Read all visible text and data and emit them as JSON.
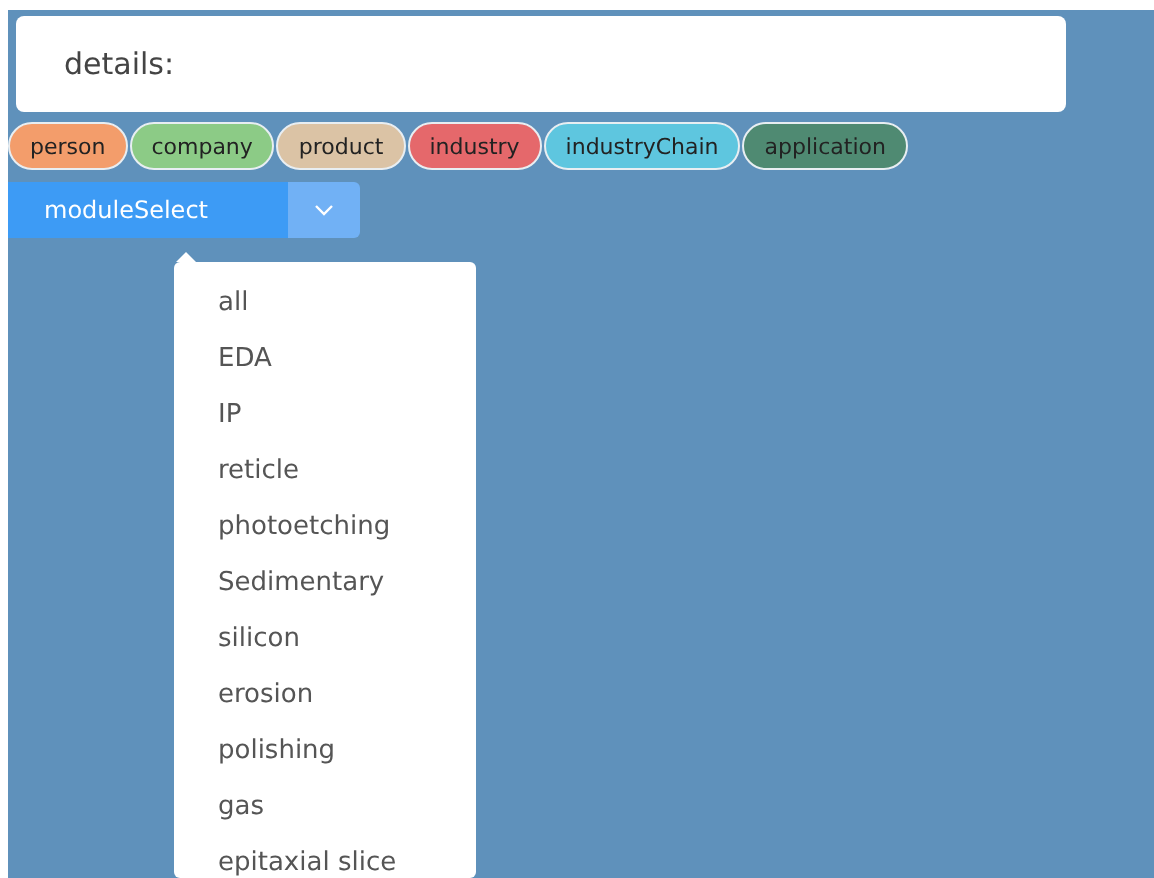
{
  "details": {
    "label": "details:"
  },
  "tags": [
    {
      "label": "person",
      "color": "#f39d6b"
    },
    {
      "label": "company",
      "color": "#8ccb86"
    },
    {
      "label": "product",
      "color": "#dbc3a5"
    },
    {
      "label": "industry",
      "color": "#e5686b"
    },
    {
      "label": "industryChain",
      "color": "#5ec6df"
    },
    {
      "label": "application",
      "color": "#4f8a72"
    }
  ],
  "module_select": {
    "label": "moduleSelect",
    "expanded": true
  },
  "menu": {
    "items": [
      "all",
      "EDA",
      "IP",
      "reticle",
      "photoetching",
      "Sedimentary",
      "silicon",
      "erosion",
      "polishing",
      "gas",
      "epitaxial slice"
    ]
  }
}
